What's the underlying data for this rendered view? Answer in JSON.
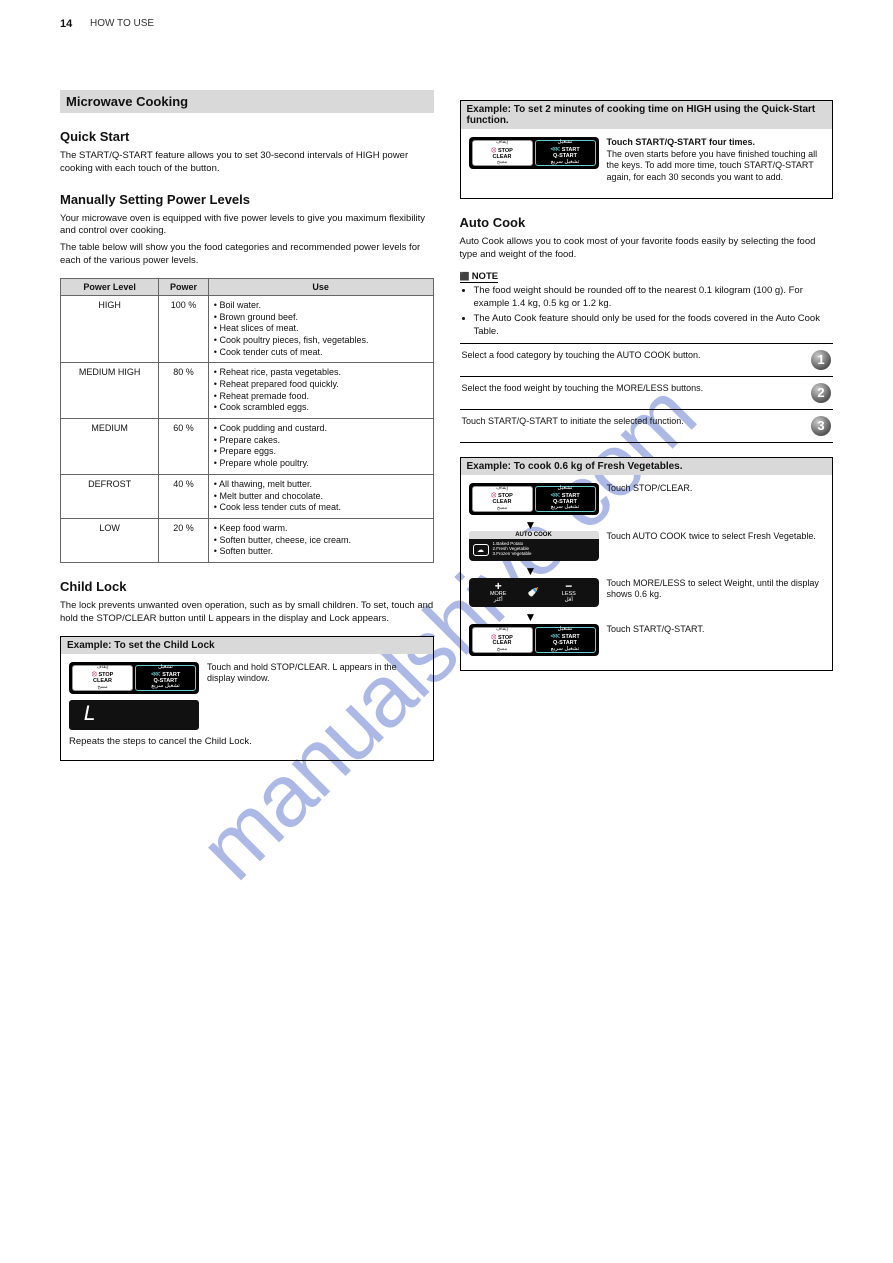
{
  "page_number": "14",
  "breadcrumb": "HOW TO USE",
  "watermark": "manualshive.com",
  "left": {
    "title_bar": "Microwave Cooking",
    "sub1_title": "Quick Start",
    "sub1_text": "The START/Q-START feature allows you to set 30-second intervals of HIGH power cooking with each touch of the button.",
    "sub2_title": "Manually Setting Power Levels",
    "sub2_p1": "Your microwave oven is equipped with five power levels to give you maximum flexibility and control over cooking.",
    "sub2_p2": "The table below will show you the food categories and recommended power levels for each of the various power levels.",
    "table_headers": [
      "Power Level",
      "Power",
      "Use"
    ],
    "table_rows": [
      {
        "level": "HIGH",
        "power": "100 %",
        "use": [
          "Boil water.",
          "Brown ground beef.",
          "Heat slices of meat.",
          "Cook poultry pieces, fish, vegetables.",
          "Cook tender cuts of meat."
        ]
      },
      {
        "level": "MEDIUM HIGH",
        "power": "80 %",
        "use": [
          "Reheat rice, pasta vegetables.",
          "Reheat prepared food quickly.",
          "Reheat premade food.",
          "Cook scrambled eggs."
        ]
      },
      {
        "level": "MEDIUM",
        "power": "60 %",
        "use": [
          "Cook pudding and custard.",
          "Prepare cakes.",
          "Prepare eggs.",
          "Prepare whole poultry."
        ]
      },
      {
        "level": "DEFROST",
        "power": "40 %",
        "use": [
          "All thawing, melt butter.",
          "Melt butter and chocolate.",
          "Cook less tender cuts of meat."
        ]
      },
      {
        "level": "LOW",
        "power": "20 %",
        "use": [
          "Keep food warm.",
          "Soften butter, cheese, ice cream.",
          "Soften butter."
        ]
      }
    ],
    "sub3_title": "Child Lock",
    "sub3_text": "The lock prevents unwanted oven operation, such as by small children. To set, touch and hold the STOP/CLEAR button until L appears in the display and Lock appears.",
    "ex_head": "Example: To set the Child Lock",
    "ex_step": "Touch and hold STOP/CLEAR. L appears in the display window.",
    "display_value": "L",
    "note_line": "Repeats the steps to cancel the Child Lock."
  },
  "right": {
    "ex1_head": "Example: To set 2 minutes of cooking time on HIGH using the Quick-Start function.",
    "ex1_step_title": "Touch START/Q-START four times.",
    "ex1_step_body": "The oven starts before you have finished touching all the keys. To add more time, touch START/Q-START again, for each 30 seconds you want to add.",
    "sub_title": "Auto Cook",
    "sub_text1": "Auto Cook allows you to cook most of your favorite foods easily by selecting the food type and weight of the food.",
    "note_title": "NOTE",
    "notes": [
      "The food weight should be rounded off to the nearest 0.1 kilogram (100 g). For example 1.4 kg, 0.5 kg or 1.2 kg.",
      "The Auto Cook feature should only be used for the foods covered in the Auto Cook Table."
    ],
    "steps": [
      "Select a food category by touching the AUTO COOK button.",
      "Select the food weight by touching the MORE/LESS buttons.",
      "Touch START/Q-START to initiate the selected function."
    ],
    "ex2_head": "Example: To cook 0.6 kg of Fresh Vegetables.",
    "ex2_steps": [
      "Touch STOP/CLEAR.",
      "Touch AUTO COOK twice to select Fresh Vegetable.",
      "Touch MORE/LESS to select Weight, until the display shows 0.6 kg.",
      "Touch START/Q-START."
    ],
    "autocook_label": "AUTO COOK",
    "menu_items": [
      "1.Baked Potato",
      "2.Fresh Vegetable",
      "3.Frozen Vegetable"
    ],
    "more_label": "MORE",
    "less_label": "LESS",
    "more_ar": "أكثر",
    "less_ar": "أقل"
  },
  "btn": {
    "stop_ar": "إيقاف",
    "stop": "STOP",
    "clear": "CLEAR",
    "clear_ar": "مسح",
    "start_ar": "تشغيل",
    "start": "START",
    "qstart": "Q-START",
    "qstart_ar": "تشغيل سريع"
  }
}
